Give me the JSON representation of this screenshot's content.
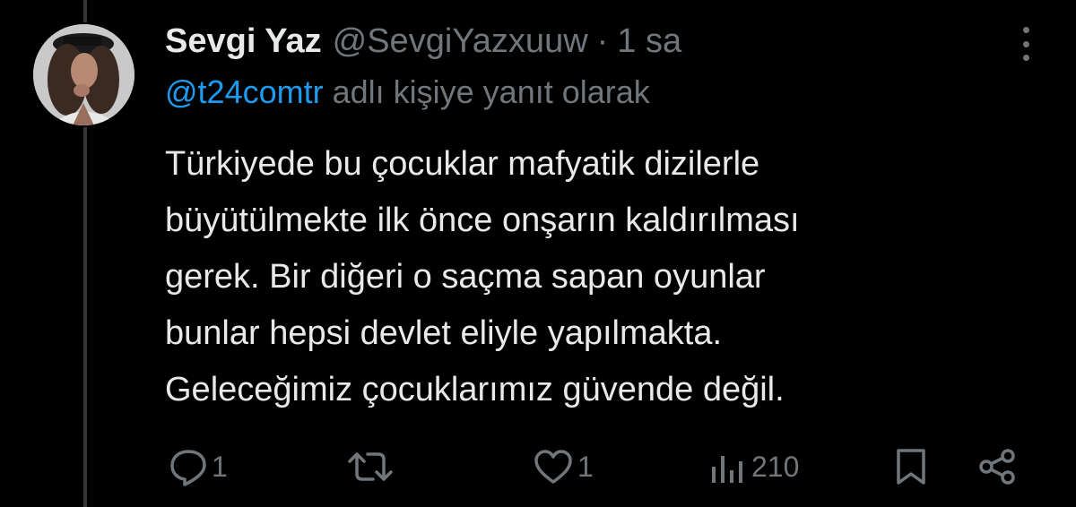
{
  "tweet": {
    "display_name": "Sevgi Yaz",
    "handle": "@SevgiYazxuuw",
    "separator": "·",
    "time": "1 sa",
    "reply_to": {
      "mention": "@t24comtr",
      "suffix": "adlı kişiye yanıt olarak"
    },
    "body_lines": [
      "Türkiyede bu çocuklar mafyatik dizilerle",
      "büyütülmekte ilk önce onşarın kaldırılması",
      "gerek. Bir diğeri o saçma sapan oyunlar",
      "bunlar hepsi devlet eliyle yapılmakta.",
      "Geleceğimiz çocuklarımız güvende değil."
    ]
  },
  "actions": {
    "reply": {
      "icon": "reply-icon",
      "count": "1"
    },
    "retweet": {
      "icon": "retweet-icon",
      "count": ""
    },
    "like": {
      "icon": "heart-icon",
      "count": "1"
    },
    "views": {
      "icon": "views-icon",
      "count": "210"
    },
    "bookmark": {
      "icon": "bookmark-icon"
    },
    "share": {
      "icon": "share-icon"
    }
  },
  "colors": {
    "background": "#000000",
    "text_primary": "#e7e9ea",
    "text_secondary": "#71767b",
    "mention": "#1d9bf0",
    "thread_line": "#333639"
  }
}
